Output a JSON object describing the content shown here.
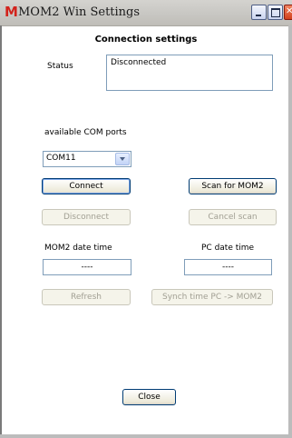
{
  "window": {
    "app_icon": "M",
    "title": "MOM2 Win Settings",
    "controls": [
      "minimize-icon",
      "maximize-icon",
      "close-icon"
    ]
  },
  "form": {
    "heading": "Connection settings",
    "status_label": "Status",
    "status_value": "Disconnected",
    "ports_label": "available COM ports",
    "port_selected": "COM11",
    "connect_label": "Connect",
    "scan_label": "Scan for MOM2",
    "disconnect_label": "Disconnect",
    "cancel_scan_label": "Cancel scan",
    "mom2_dt_label": "MOM2 date time",
    "pc_dt_label": "PC date time",
    "mom2_dt_value": "----",
    "pc_dt_value": "----",
    "refresh_label": "Refresh",
    "synch_label": "Synch time PC -> MOM2",
    "close_label": "Close"
  },
  "states": {
    "disconnect_enabled": false,
    "cancel_scan_enabled": false,
    "refresh_enabled": false,
    "synch_enabled": false
  }
}
